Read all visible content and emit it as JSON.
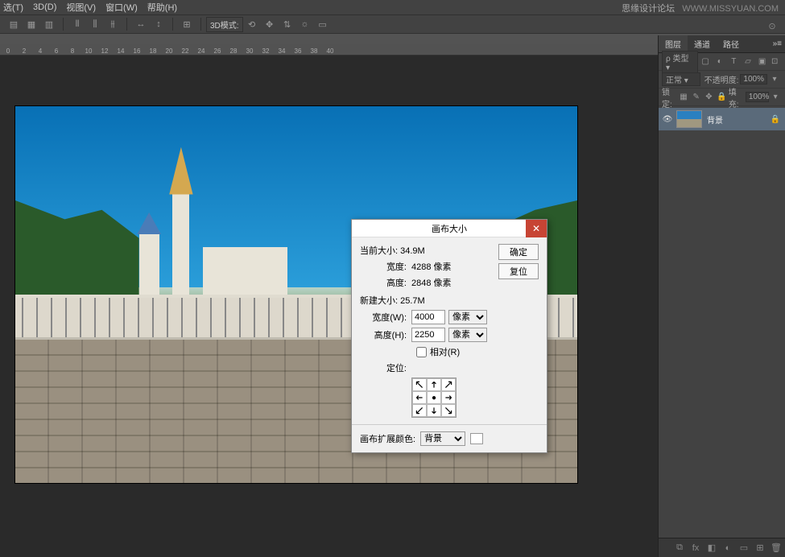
{
  "watermark": {
    "cn_text": "思缘设计论坛",
    "url": "WWW.MISSYUAN.COM"
  },
  "menu": {
    "select": "选(T)",
    "d3": "3D(D)",
    "view": "视图(V)",
    "window": "窗口(W)",
    "help": "帮助(H)"
  },
  "toolbar": {
    "d3_mode": "3D模式:"
  },
  "layers_panel": {
    "tabs": {
      "layers": "图层",
      "channels": "通道",
      "paths": "路径"
    },
    "filter_label": "类型",
    "blend_mode": "正常",
    "opacity_label": "不透明度:",
    "opacity_value": "100%",
    "lock_label": "锁定:",
    "fill_label": "填充:",
    "fill_value": "100%",
    "layer": {
      "name": "背景"
    }
  },
  "dialog": {
    "title": "画布大小",
    "ok": "确定",
    "cancel": "复位",
    "current_size_label": "当前大小: 34.9M",
    "current_width_label": "宽度:",
    "current_width_value": "4288 像素",
    "current_height_label": "高度:",
    "current_height_value": "2848 像素",
    "new_size_label": "新建大小: 25.7M",
    "new_width_label": "宽度(W):",
    "new_width_value": "4000",
    "new_height_label": "高度(H):",
    "new_height_value": "2250",
    "unit": "像素",
    "relative_label": "相对(R)",
    "anchor_label": "定位:",
    "ext_color_label": "画布扩展颜色:",
    "ext_color_value": "背景"
  }
}
